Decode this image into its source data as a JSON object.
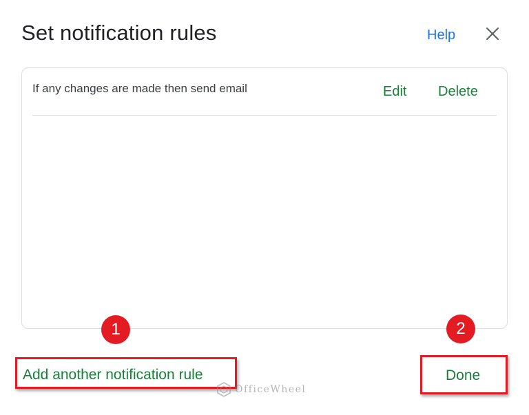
{
  "dialog": {
    "title": "Set notification rules",
    "help_label": "Help",
    "close_icon": "close-icon"
  },
  "rules": [
    {
      "text": "If any changes are made then send email",
      "edit_label": "Edit",
      "delete_label": "Delete"
    }
  ],
  "footer": {
    "add_rule_label": "Add another notification rule",
    "done_label": "Done"
  },
  "annotations": {
    "step1": "1",
    "step2": "2"
  },
  "watermark": {
    "text": "OfficeWheel",
    "logo_icon": "officewheel-logo-icon"
  },
  "colors": {
    "title": "#202124",
    "help_link": "#1a73e8",
    "action_green": "#188038",
    "highlight_red": "#e31b23",
    "border": "#dadce0"
  }
}
